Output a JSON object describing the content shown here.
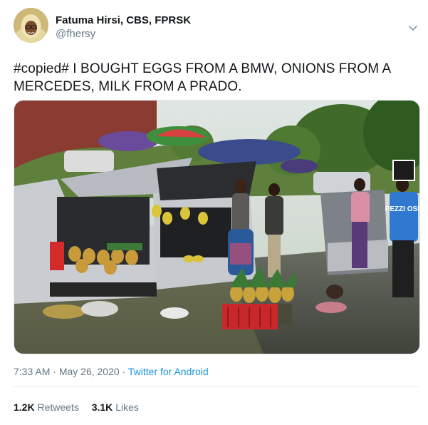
{
  "user": {
    "display_name": "Fatuma Hirsi, CBS, FPRSK",
    "handle": "@fhersy",
    "avatar_icon": "profile-photo-hijab-woman"
  },
  "menu": {
    "icon": "chevron-down-icon"
  },
  "tweet": {
    "text": "#copied# I BOUGHT EGGS FROM A BMW, ONIONS FROM A MERCEDES, MILK FROM A PRADO.",
    "image": {
      "sign_text": "PEZZI OSN"
    }
  },
  "meta": {
    "time": "7:33 AM",
    "sep1": " · ",
    "date": "May 26, 2020",
    "sep2": " · ",
    "source": "Twitter for Android"
  },
  "stats": {
    "retweets_count": "1.2K",
    "retweets_label": "Retweets",
    "likes_count": "3.1K",
    "likes_label": "Likes"
  },
  "colors": {
    "link": "#1b95e0",
    "muted": "#657786",
    "text": "#14171a"
  }
}
